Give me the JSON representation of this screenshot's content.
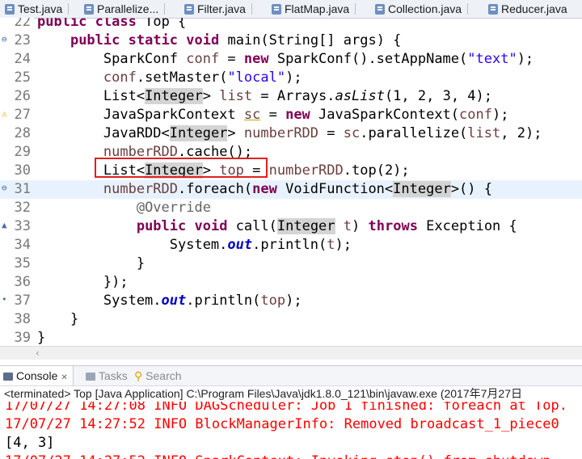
{
  "tabs": [
    {
      "label": "Test.java",
      "icon": "java-file-icon"
    },
    {
      "label": "Parallelize...",
      "icon": "java-file-icon"
    },
    {
      "label": "Filter.java",
      "icon": "java-file-icon"
    },
    {
      "label": "FlatMap.java",
      "icon": "java-file-icon"
    },
    {
      "label": "Collection.java",
      "icon": "java-file-icon"
    },
    {
      "label": "Reducer.java",
      "icon": "java-file-icon"
    }
  ],
  "editor": {
    "lines": [
      {
        "n": "22",
        "text": "public class Top {"
      },
      {
        "n": "23",
        "text": "    public static void main(String[] args) {"
      },
      {
        "n": "24",
        "text": "        SparkConf conf = new SparkConf().setAppName(\"text\");"
      },
      {
        "n": "25",
        "text": "        conf.setMaster(\"local\");"
      },
      {
        "n": "26",
        "text": "        List<Integer> list = Arrays.asList(1, 2, 3, 4);"
      },
      {
        "n": "27",
        "text": "        JavaSparkContext sc = new JavaSparkContext(conf);"
      },
      {
        "n": "28",
        "text": "        JavaRDD<Integer> numberRDD = sc.parallelize(list, 2);"
      },
      {
        "n": "29",
        "text": "        numberRDD.cache();"
      },
      {
        "n": "30",
        "text": "        List<Integer> top = numberRDD.top(2);"
      },
      {
        "n": "31",
        "text": "        numberRDD.foreach(new VoidFunction<Integer>() {"
      },
      {
        "n": "32",
        "text": "            @Override"
      },
      {
        "n": "33",
        "text": "            public void call(Integer t) throws Exception {"
      },
      {
        "n": "34",
        "text": "                System.out.println(t);"
      },
      {
        "n": "35",
        "text": "            }"
      },
      {
        "n": "36",
        "text": "        });"
      },
      {
        "n": "37",
        "text": "        System.out.println(top);"
      },
      {
        "n": "38",
        "text": "    }"
      },
      {
        "n": "39",
        "text": "}"
      }
    ]
  },
  "console": {
    "tabs": {
      "console": "Console",
      "tasks": "Tasks",
      "search": "Search"
    },
    "terminated": "<terminated> Top [Java Application] C:\\Program Files\\Java\\jdk1.8.0_121\\bin\\javaw.exe (2017年7月27日",
    "lines": [
      "17/07/27 14:27:08 INFO DAGScheduler: Job 1 finished: foreach at Top.",
      "17/07/27 14:27:52 INFO BlockManagerInfo: Removed broadcast_1_piece0",
      "[4, 3]",
      "17/07/27 14:27:52 INFO SparkContext: Invoking stop() from shutdown"
    ]
  },
  "colors": {
    "keyword": "#7f0055",
    "string": "#2a00ff",
    "highlight_box": "#e02020",
    "console_error": "#ff0000"
  }
}
